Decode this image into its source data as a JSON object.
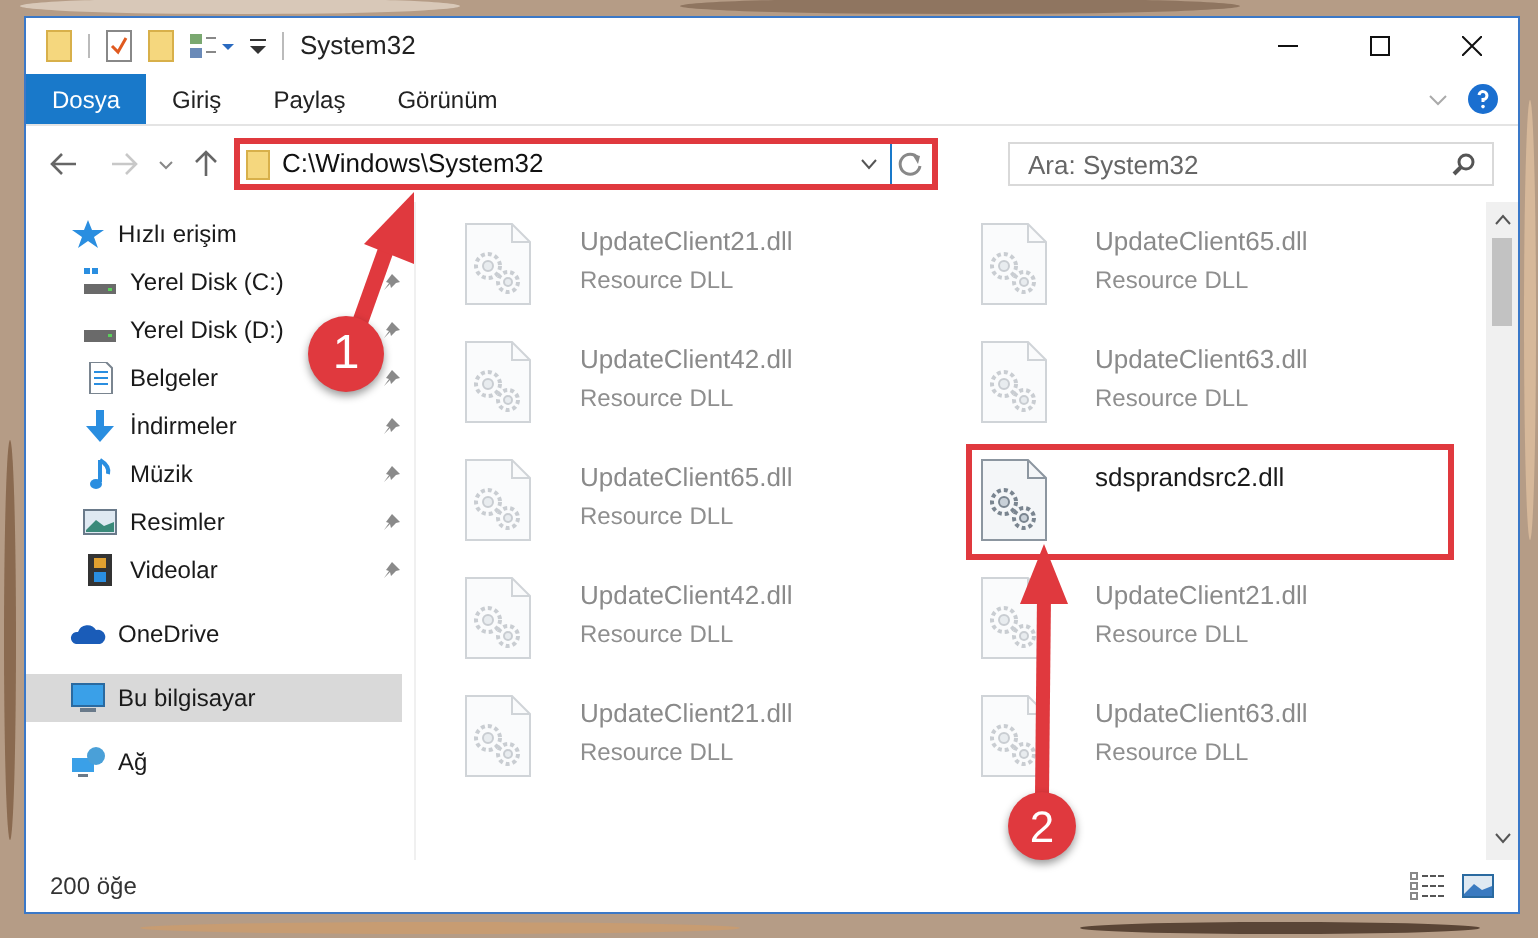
{
  "window": {
    "title": "System32"
  },
  "ribbon_tabs": [
    {
      "label": "Dosya",
      "selected": true
    },
    {
      "label": "Giriş",
      "selected": false
    },
    {
      "label": "Paylaş",
      "selected": false
    },
    {
      "label": "Görünüm",
      "selected": false
    }
  ],
  "address": {
    "value": "C:\\Windows\\System32",
    "highlighted": true
  },
  "search": {
    "placeholder": "Ara: System32"
  },
  "sidebar": {
    "items": [
      {
        "label": "Hızlı erişim",
        "kind": "star",
        "selected": false,
        "children": [
          {
            "label": "Yerel Disk (C:)",
            "kind": "disk-c",
            "pinned": true,
            "selected": false
          },
          {
            "label": "Yerel Disk (D:)",
            "kind": "disk",
            "pinned": true,
            "selected": false
          },
          {
            "label": "Belgeler",
            "kind": "docs",
            "pinned": true,
            "selected": false
          },
          {
            "label": "İndirmeler",
            "kind": "download",
            "pinned": true,
            "selected": false
          },
          {
            "label": "Müzik",
            "kind": "music",
            "pinned": true,
            "selected": false
          },
          {
            "label": "Resimler",
            "kind": "pictures",
            "pinned": true,
            "selected": false
          },
          {
            "label": "Videolar",
            "kind": "videos",
            "pinned": true,
            "selected": false
          }
        ]
      },
      {
        "label": "OneDrive",
        "kind": "cloud",
        "selected": false
      },
      {
        "label": "Bu bilgisayar",
        "kind": "pc",
        "selected": true
      },
      {
        "label": "Ağ",
        "kind": "network",
        "selected": false
      }
    ]
  },
  "files": [
    {
      "name": "UpdateClient21.dll",
      "type": "Resource DLL",
      "blurred": true,
      "highlighted": false
    },
    {
      "name": "UpdateClient65.dll",
      "type": "Resource DLL",
      "blurred": true,
      "highlighted": false
    },
    {
      "name": "UpdateClient42.dll",
      "type": "Resource DLL",
      "blurred": true,
      "highlighted": false
    },
    {
      "name": "UpdateClient63.dll",
      "type": "Resource DLL",
      "blurred": true,
      "highlighted": false
    },
    {
      "name": "UpdateClient65.dll",
      "type": "Resource DLL",
      "blurred": true,
      "highlighted": false
    },
    {
      "name": "sdsprandsrc2.dll",
      "blurred": false,
      "highlighted": true
    },
    {
      "name": "UpdateClient42.dll",
      "type": "Resource DLL",
      "blurred": true,
      "highlighted": false
    },
    {
      "name": "UpdateClient21.dll",
      "type": "Resource DLL",
      "blurred": true,
      "highlighted": false
    },
    {
      "name": "UpdateClient21.dll",
      "type": "Resource DLL",
      "blurred": true,
      "highlighted": false
    },
    {
      "name": "UpdateClient63.dll",
      "type": "Resource DLL",
      "blurred": true,
      "highlighted": false
    }
  ],
  "status_bar": {
    "count": "200 öğe"
  },
  "annotations": [
    {
      "number": "1"
    },
    {
      "number": "2"
    }
  ]
}
